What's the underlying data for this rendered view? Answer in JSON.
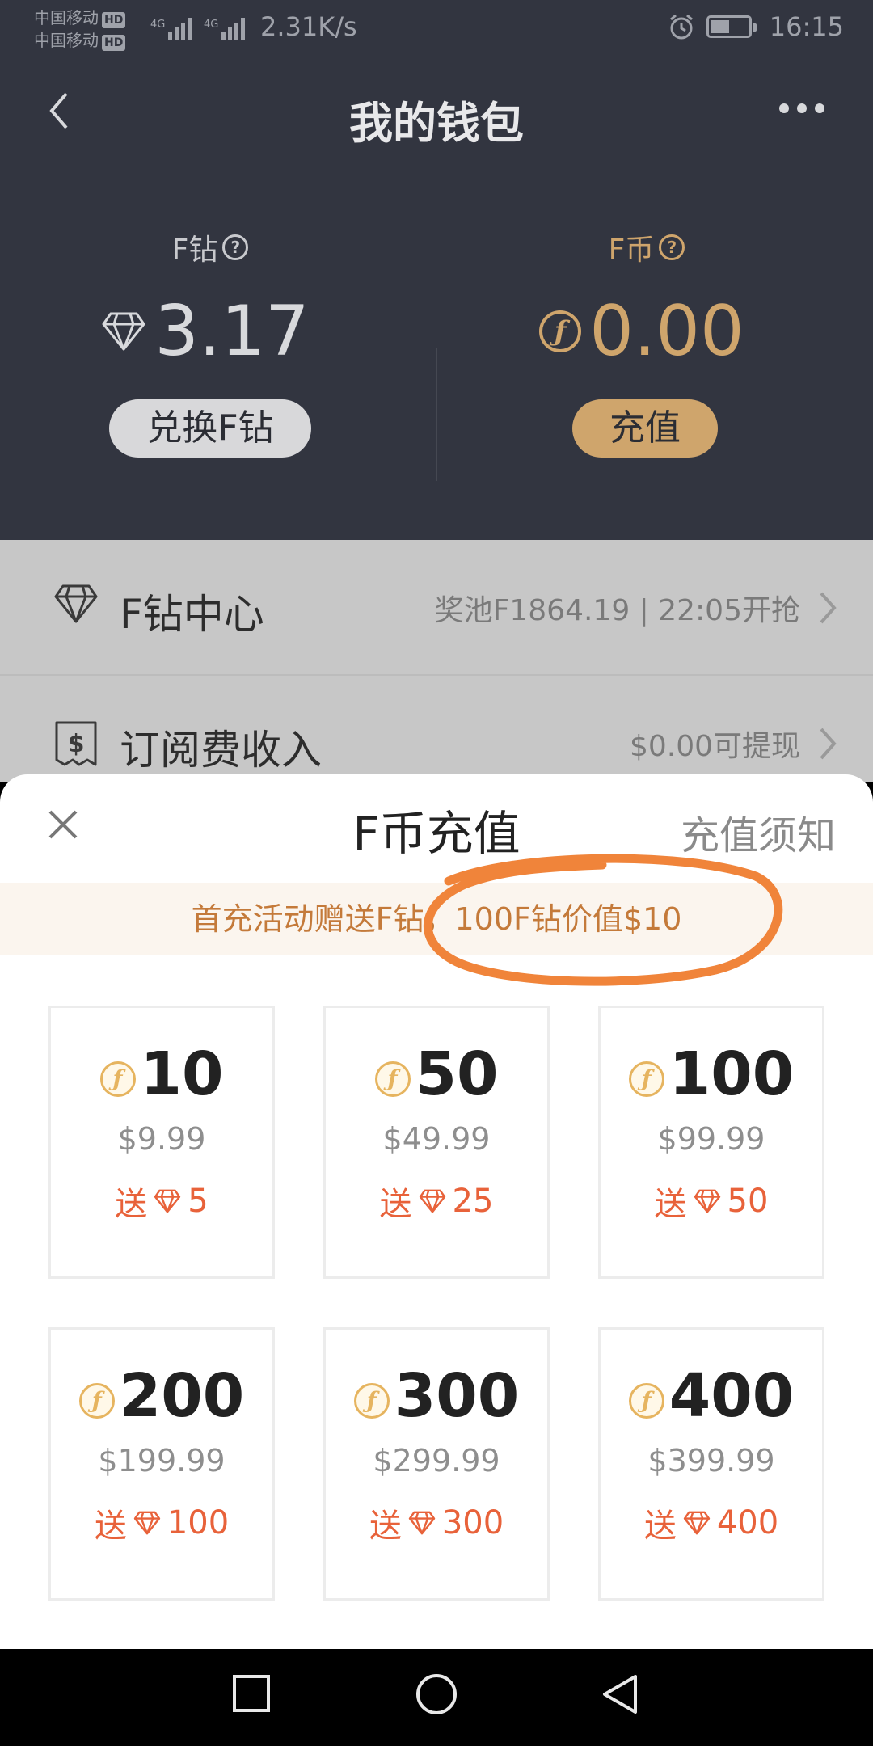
{
  "status_bar": {
    "carrier_1": "中国移动",
    "carrier_2": "中国移动",
    "hd": "HD",
    "speed": "2.31K/s",
    "time": "16:15"
  },
  "header": {
    "title": "我的钱包"
  },
  "balances": {
    "f_diamond": {
      "label": "F钻",
      "value": "3.17",
      "button": "兑换F钻"
    },
    "f_coin": {
      "label": "F币",
      "value": "0.00",
      "button": "充值"
    }
  },
  "list": [
    {
      "title": "F钻中心",
      "subtitle": "奖池F1864.19 | 22:05开抢"
    },
    {
      "title": "订阅费收入",
      "subtitle": "$0.00可提现"
    }
  ],
  "sheet": {
    "title": "F币充值",
    "notice_link": "充值须知",
    "promo": "首充活动赠送F钻，100F钻价值$10",
    "bonus_prefix": "送",
    "packages": [
      {
        "amount": "10",
        "price": "$9.99",
        "bonus": "5"
      },
      {
        "amount": "50",
        "price": "$49.99",
        "bonus": "25"
      },
      {
        "amount": "100",
        "price": "$99.99",
        "bonus": "50"
      },
      {
        "amount": "200",
        "price": "$199.99",
        "bonus": "100"
      },
      {
        "amount": "300",
        "price": "$299.99",
        "bonus": "300"
      },
      {
        "amount": "400",
        "price": "$399.99",
        "bonus": "400"
      }
    ]
  },
  "icons": {
    "diamond": "diamond-icon",
    "coin": "f-coin-icon",
    "help": "help-icon",
    "receipt": "dollar-receipt-icon",
    "annotation": "orange-circle-annotation"
  },
  "colors": {
    "header_bg": "#323540",
    "gold": "#cfa56c",
    "bonus": "#e8623a",
    "promo_text": "#c47a3a",
    "annotation": "#f0843a"
  }
}
